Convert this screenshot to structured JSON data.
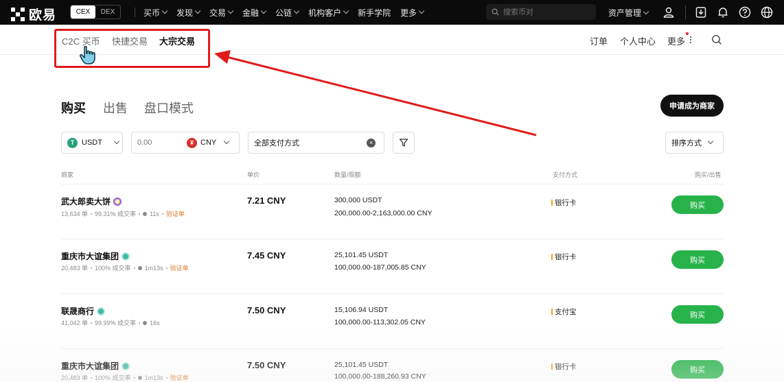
{
  "topbar": {
    "logo_text": "欧易",
    "cex": "CEX",
    "dex": "DEX",
    "nav": [
      "买币",
      "发现",
      "交易",
      "金融",
      "公链",
      "机构客户",
      "新手学院",
      "更多"
    ],
    "search_placeholder": "搜索币对",
    "asset_label": "资产管理"
  },
  "subnav": {
    "tabs": [
      "C2C 买币",
      "快捷交易",
      "大宗交易"
    ],
    "active_tab": "大宗交易",
    "links": [
      "订单",
      "个人中心",
      "更多"
    ]
  },
  "main": {
    "tabs": [
      "购买",
      "出售",
      "盘口模式"
    ],
    "active_tab": "购买",
    "merchant_button": "申请成为商家"
  },
  "filters": {
    "coin": "USDT",
    "amount_placeholder": "0.00",
    "fiat": "CNY",
    "payment": "全部支付方式",
    "sort": "排序方式"
  },
  "table": {
    "headers": [
      "商家",
      "单价",
      "数量/限额",
      "支付方式",
      "购买/出售"
    ],
    "rows": [
      {
        "name": "武大郎卖大饼",
        "badge": "purple",
        "orders": "13,634 单",
        "rate": "99.31% 成交率",
        "time": "11s",
        "verify": "验证单",
        "price": "7.21 CNY",
        "qty": "300,000 USDT",
        "limit": "200,000.00-2,163,000.00 CNY",
        "pay": "银行卡",
        "action": "购买"
      },
      {
        "name": "重庆市大谊集团",
        "badge": "teal",
        "orders": "20,483 单",
        "rate": "100% 成交率",
        "time": "1m13s",
        "verify": "验证单",
        "price": "7.45 CNY",
        "qty": "25,101.45 USDT",
        "limit": "100,000.00-187,005.85 CNY",
        "pay": "银行卡",
        "action": "购买"
      },
      {
        "name": "联晟商行",
        "badge": "teal",
        "orders": "41,042 单",
        "rate": "99.99% 成交率",
        "time": "16s",
        "verify": "",
        "price": "7.50 CNY",
        "qty": "15,106.94 USDT",
        "limit": "100,000.00-113,302.05 CNY",
        "pay": "支付宝",
        "action": "购买"
      },
      {
        "name": "重庆市大谊集团",
        "badge": "teal",
        "orders": "20,483 单",
        "rate": "100% 成交率",
        "time": "1m13s",
        "verify": "验证单",
        "price": "7.50 CNY",
        "qty": "25,101.45 USDT",
        "limit": "100,000.00-188,260.93 CNY",
        "pay": "银行卡",
        "action": "购买"
      }
    ]
  },
  "colors": {
    "accent_green": "#27b34a",
    "annotation_red": "#e01b1b",
    "verify_orange": "#d97a2a"
  }
}
